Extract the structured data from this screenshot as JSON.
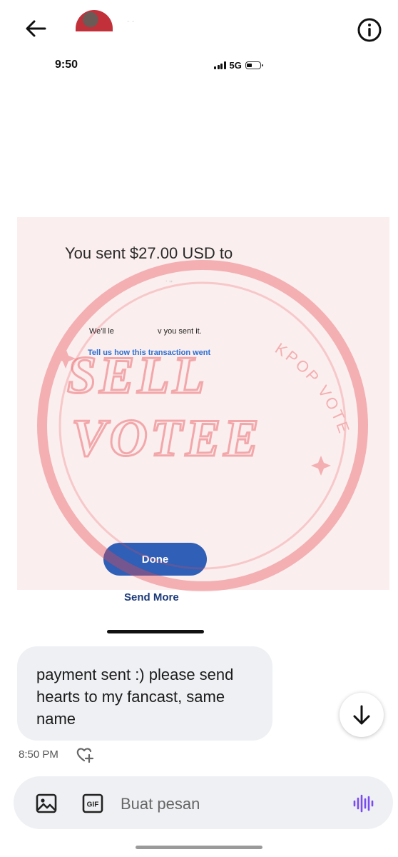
{
  "header": {
    "contact_name": "- -",
    "back_icon": "arrow-left-icon",
    "info_icon": "info-circle-icon"
  },
  "shared_screenshot": {
    "status_bar": {
      "time": "9:50",
      "network": "5G"
    },
    "receipt": {
      "sent_text": "You sent $27.00 USD to",
      "recipient": ". ,,",
      "notice": "We'll le                    v you sent it.",
      "feedback_link": "Tell us how this transaction went",
      "done_button": "Done",
      "send_more_link": "Send More"
    },
    "watermark": {
      "main_line1": "SELL",
      "main_line2": "VOTEE",
      "arc_text": "KPOP VOTE",
      "color": "#e84a50"
    },
    "colors": {
      "done_button": "#2f5fb6",
      "link": "#2b6fd3",
      "receipt_bg": "#fbeeee"
    }
  },
  "message": {
    "text": "payment sent :) please send\nhearts to my fancast, same\nname",
    "time": "8:50 PM",
    "react_icon": "heart-plus-icon"
  },
  "scroll_down_icon": "arrow-down-icon",
  "composer": {
    "image_icon": "image-icon",
    "gif_label": "GIF",
    "placeholder": "Buat pesan",
    "voice_icon": "voice-waveform-icon",
    "voice_color": "#7a4cf0"
  }
}
